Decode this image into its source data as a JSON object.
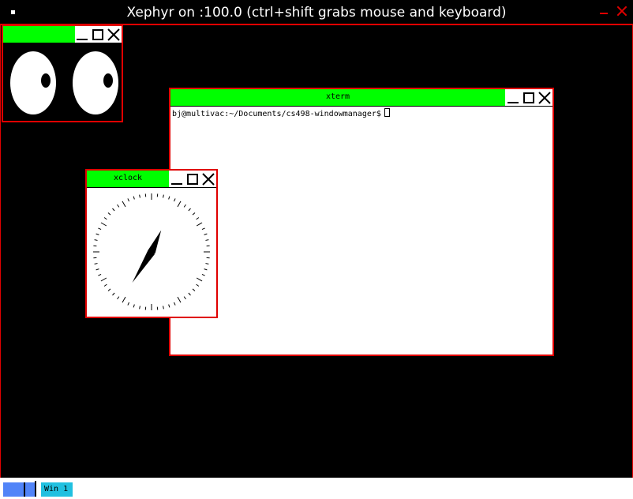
{
  "host_window": {
    "title": "Xephyr on :100.0 (ctrl+shift grabs mouse and keyboard)",
    "icons": {
      "app": "app-menu-icon",
      "minimize": "minimize-icon",
      "close": "close-icon"
    }
  },
  "colors": {
    "frame_border": "#e00000",
    "titlebar_active": "#00ff00",
    "desktop": "#000000",
    "taskbar_bg": "#ffffff",
    "workspace": "#5184f8",
    "task_item": "#20c0e0"
  },
  "windows": {
    "xeyes": {
      "title": ""
    },
    "xterm": {
      "title": "xterm",
      "prompt": "bj@multivac:~/Documents/cs498-windowmanager$"
    },
    "xclock": {
      "title": "xclock",
      "time_shown": "7:04"
    }
  },
  "window_buttons": [
    "minimize-icon",
    "maximize-icon",
    "close-icon"
  ],
  "taskbar": {
    "workspace_label": "",
    "items": [
      {
        "label": "Win 1"
      }
    ]
  }
}
